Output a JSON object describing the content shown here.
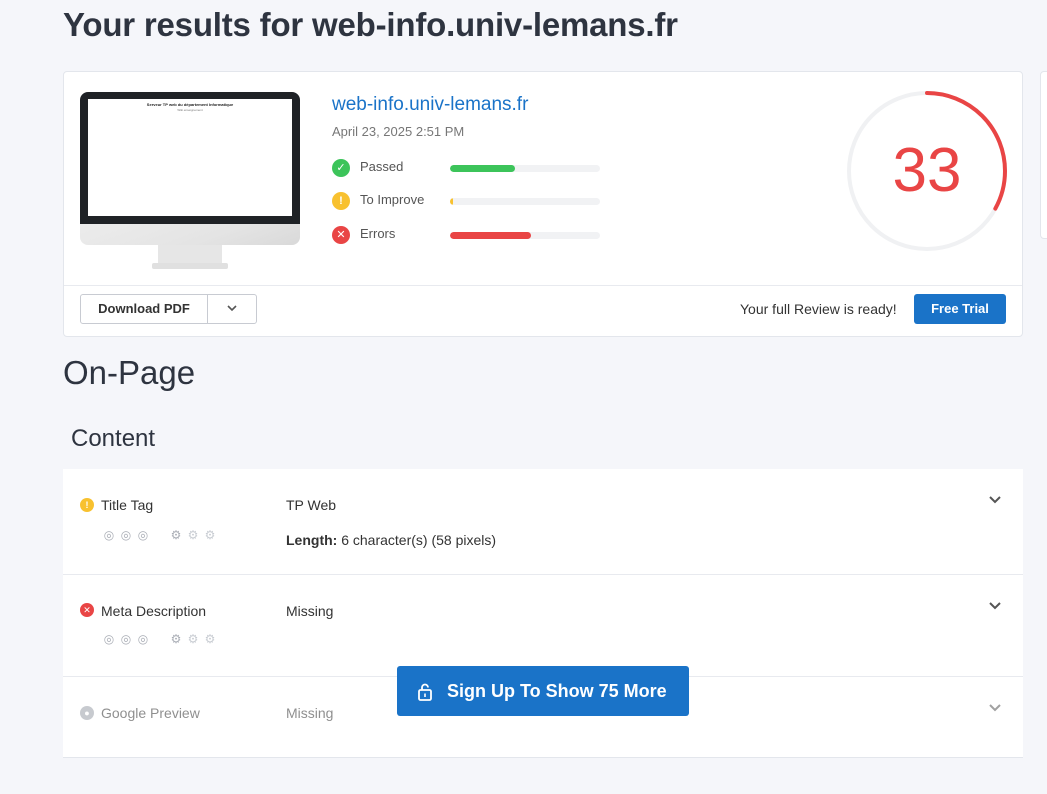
{
  "header": {
    "title": "Your results for web-info.univ-lemans.fr"
  },
  "summary": {
    "preview": {
      "screen_heading": "Serveur TP web du département Informatique",
      "screen_sub": "Wiki enseignement"
    },
    "site_link": "web-info.univ-lemans.fr",
    "date": "April 23, 2025 2:51 PM",
    "stats": [
      {
        "label": "Passed",
        "icon": "check-icon",
        "color": "#3cc45a",
        "fraction": 0.43
      },
      {
        "label": "To Improve",
        "icon": "exclamation-icon",
        "color": "#f8c12f",
        "fraction": 0.02
      },
      {
        "label": "Errors",
        "icon": "x-icon",
        "color": "#e94545",
        "fraction": 0.54
      }
    ],
    "score": {
      "value": "33",
      "fraction": 0.33,
      "color": "#e94545"
    },
    "download_label": "Download PDF",
    "ready_text": "Your full Review is ready!",
    "trial_label": "Free Trial"
  },
  "section": {
    "title": "On-Page",
    "subtitle": "Content"
  },
  "audits": [
    {
      "name": "Title Tag",
      "status": "warning",
      "value": "TP Web",
      "detail_label": "Length:",
      "detail_value": " 6 character(s) (58 pixels)"
    },
    {
      "name": "Meta Description",
      "status": "error",
      "value": "Missing"
    },
    {
      "name": "Google Preview",
      "status": "hidden",
      "value": "Missing"
    }
  ],
  "signup": {
    "label": "Sign Up To Show 75 More"
  },
  "colors": {
    "accent": "#1a73c8",
    "warning": "#f8c12f",
    "error": "#e94545",
    "success": "#3cc45a"
  }
}
